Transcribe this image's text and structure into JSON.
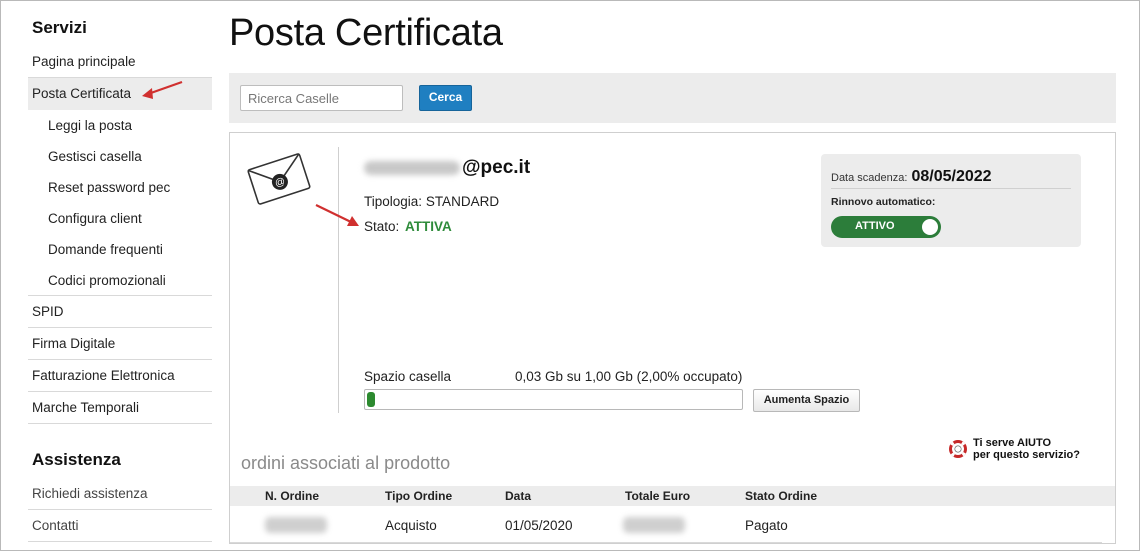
{
  "sidebar": {
    "heading": "Servizi",
    "items": [
      {
        "label": "Pagina principale"
      },
      {
        "label": "Posta Certificata"
      }
    ],
    "subitems": [
      {
        "label": "Leggi la posta"
      },
      {
        "label": "Gestisci casella"
      },
      {
        "label": "Reset password pec"
      },
      {
        "label": "Configura client"
      },
      {
        "label": "Domande frequenti"
      },
      {
        "label": "Codici promozionali"
      }
    ],
    "other_items": [
      {
        "label": "SPID"
      },
      {
        "label": "Firma Digitale"
      },
      {
        "label": "Fatturazione Elettronica"
      },
      {
        "label": "Marche Temporali"
      }
    ],
    "assist_heading": "Assistenza",
    "assist_items": [
      {
        "label": "Richiedi assistenza"
      },
      {
        "label": "Contatti"
      }
    ]
  },
  "page": {
    "title": "Posta Certificata"
  },
  "search": {
    "placeholder": "Ricerca Caselle",
    "button_label": "Cerca"
  },
  "mailbox": {
    "domain": "@pec.it",
    "tipologia_label": "Tipologia:",
    "tipologia_value": "STANDARD",
    "stato_label": "Stato:",
    "stato_value": "ATTIVA",
    "stato_color": "#2e8b3a"
  },
  "expiry": {
    "label": "Data scadenza:",
    "date": "08/05/2022",
    "renew_label": "Rinnovo automatico:",
    "toggle_label": "ATTIVO",
    "toggle_color": "#2c7d3a"
  },
  "storage": {
    "label": "Spazio casella",
    "value_text": "0,03 Gb su 1,00 Gb (2,00% occupato)",
    "used_fraction": 0.02,
    "bar_color": "#2c8a2f",
    "button_label": "Aumenta Spazio"
  },
  "help": {
    "line1": "Ti serve AIUTO",
    "line2": "per questo servizio?"
  },
  "orders": {
    "title": "ordini associati al prodotto",
    "columns": [
      "N. Ordine",
      "Tipo Ordine",
      "Data",
      "Totale Euro",
      "Stato Ordine"
    ],
    "rows": [
      {
        "tipo": "Acquisto",
        "data": "01/05/2020",
        "stato": "Pagato"
      }
    ]
  },
  "colors": {
    "primary_button": "#1f7fc1",
    "annotation_arrow": "#d0302f"
  }
}
